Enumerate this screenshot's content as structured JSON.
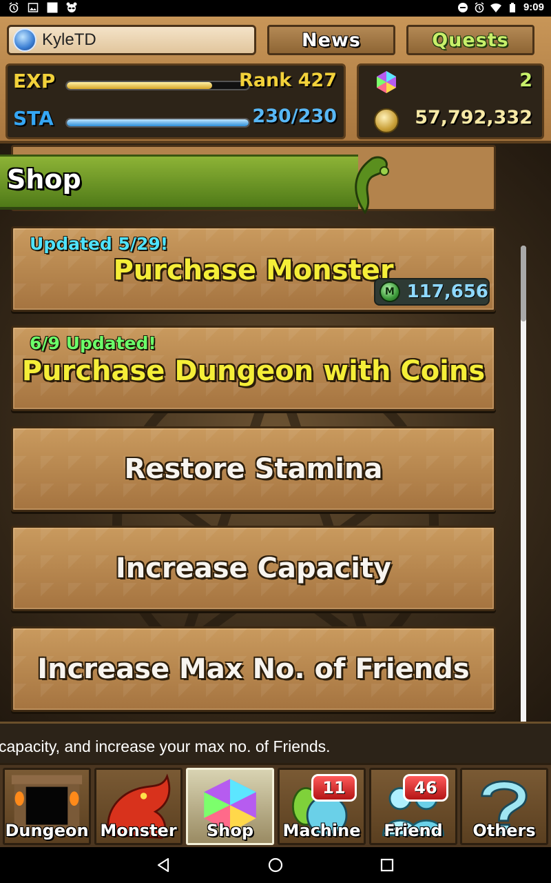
{
  "status_bar": {
    "time": "9:09",
    "left_icons": [
      "alarm-icon",
      "image-icon",
      "square-icon",
      "raccoon-icon"
    ],
    "right_icons": [
      "minus-circle-icon",
      "alarm-icon",
      "wifi-icon",
      "battery-icon"
    ]
  },
  "header": {
    "username": "KyleTD",
    "news_label": "News",
    "quests_label": "Quests",
    "exp_label": "EXP",
    "exp_progress": 0.8,
    "rank_text": "Rank 427",
    "sta_label": "STA",
    "sta_progress": 1.0,
    "sta_text": "230/230",
    "stones": "2",
    "coins": "57,792,332"
  },
  "shop": {
    "title": "Shop"
  },
  "menu": {
    "items": [
      {
        "tag": "Updated 5/29!",
        "label": "Purchase Monster",
        "points": "117,656",
        "points_icon_letter": "M"
      },
      {
        "tag": "6/9 Updated!",
        "label": "Purchase Dungeon with Coins"
      },
      {
        "label": "Restore Stamina"
      },
      {
        "label": "Increase Capacity"
      },
      {
        "label": "Increase Max No. of Friends"
      }
    ]
  },
  "ticker": {
    "text": "capacity, and increase your max no. of Friends."
  },
  "bottom_nav": {
    "items": [
      {
        "label": "Dungeon"
      },
      {
        "label": "Monster"
      },
      {
        "label": "Shop"
      },
      {
        "label": "Machine",
        "badge": "11"
      },
      {
        "label": "Friend",
        "badge": "46"
      },
      {
        "label": "Others"
      }
    ]
  },
  "colors": {
    "banner_green": "#6a9a24",
    "stone_brown": "#b3834c",
    "label_yellow": "#f5ee38",
    "tag_cyan": "#4fe3ff",
    "tag_green": "#6cff6a",
    "exp_yellow": "#f2d13a",
    "sta_blue": "#35a6f4"
  }
}
